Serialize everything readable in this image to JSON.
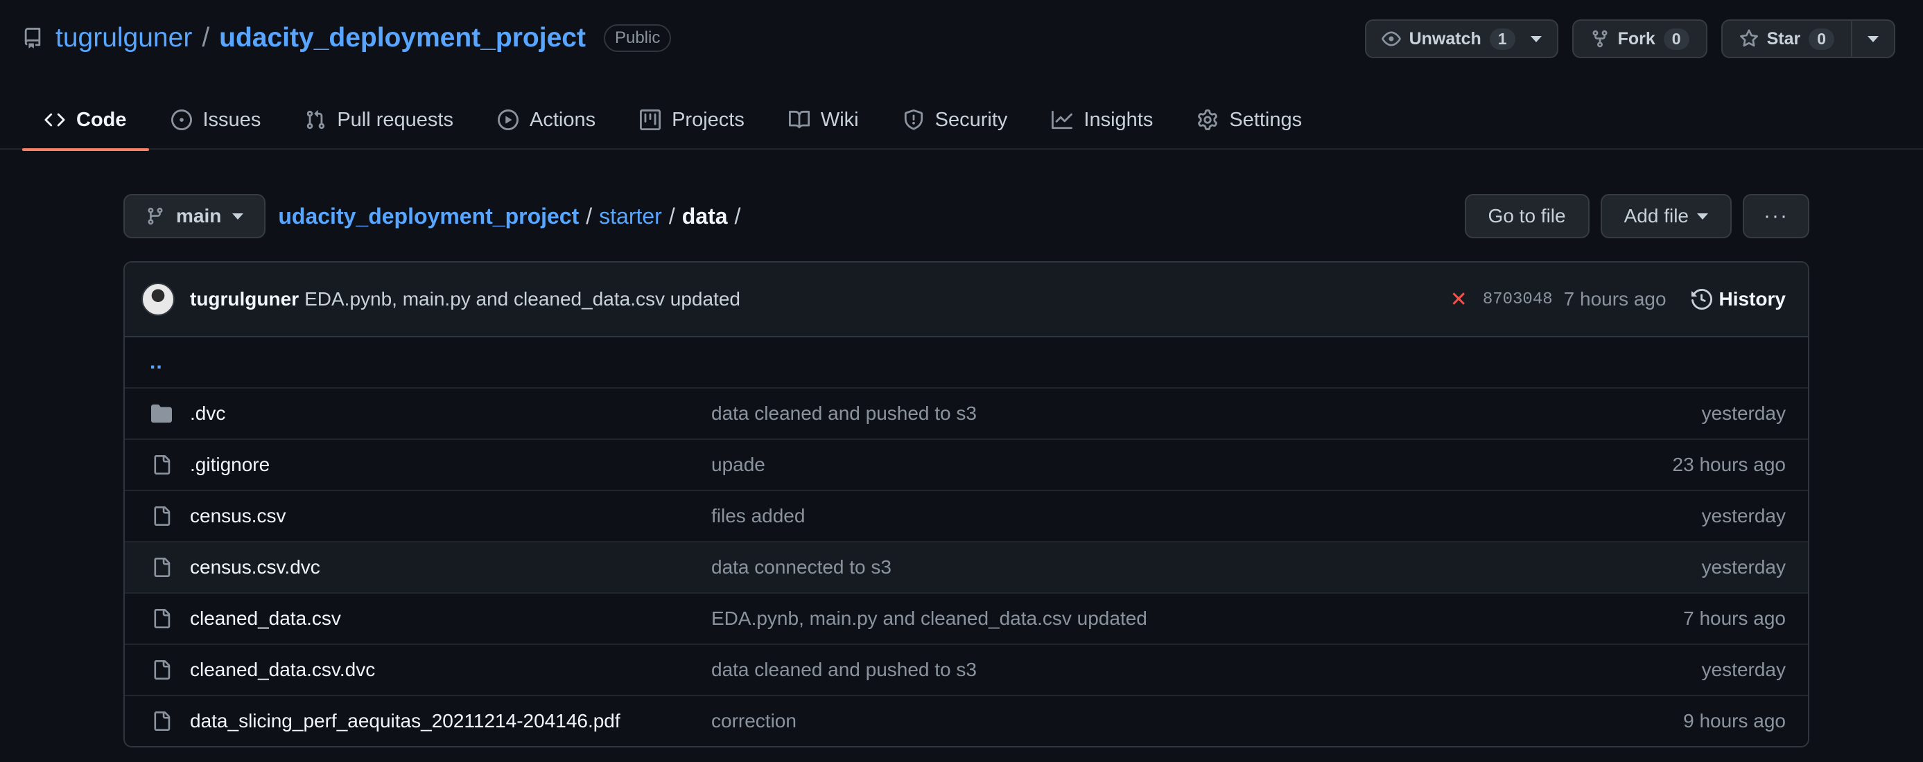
{
  "repo": {
    "owner": "tugrulguner",
    "separator": "/",
    "name": "udacity_deployment_project",
    "visibility": "Public"
  },
  "actions": {
    "watch": {
      "label": "Unwatch",
      "count": "1"
    },
    "fork": {
      "label": "Fork",
      "count": "0"
    },
    "star": {
      "label": "Star",
      "count": "0"
    }
  },
  "tabs": [
    {
      "label": "Code",
      "icon": "code-icon",
      "active": true
    },
    {
      "label": "Issues",
      "icon": "issue-icon"
    },
    {
      "label": "Pull requests",
      "icon": "pull-request-icon"
    },
    {
      "label": "Actions",
      "icon": "play-icon"
    },
    {
      "label": "Projects",
      "icon": "project-icon"
    },
    {
      "label": "Wiki",
      "icon": "book-icon"
    },
    {
      "label": "Security",
      "icon": "shield-icon"
    },
    {
      "label": "Insights",
      "icon": "graph-icon"
    },
    {
      "label": "Settings",
      "icon": "gear-icon"
    }
  ],
  "file_nav": {
    "branch": "main",
    "crumbs": {
      "root": "udacity_deployment_project",
      "sub": "starter",
      "current": "data",
      "sep": "/",
      "trail": "/"
    },
    "go_to_file": "Go to file",
    "add_file": "Add file",
    "more": "···"
  },
  "last_commit": {
    "author": "tugrulguner",
    "message": "EDA.pynb, main.py and cleaned_data.csv updated",
    "status": "✕",
    "sha": "8703048",
    "age": "7 hours ago",
    "history": "History"
  },
  "parent_dir": "..",
  "files": [
    {
      "name": ".dvc",
      "type": "dir",
      "message": "data cleaned and pushed to s3",
      "age": "yesterday"
    },
    {
      "name": ".gitignore",
      "type": "file",
      "message": "upade",
      "age": "23 hours ago"
    },
    {
      "name": "census.csv",
      "type": "file",
      "message": "files added",
      "age": "yesterday"
    },
    {
      "name": "census.csv.dvc",
      "type": "file",
      "message": "data connected to s3",
      "age": "yesterday"
    },
    {
      "name": "cleaned_data.csv",
      "type": "file",
      "message": "EDA.pynb, main.py and cleaned_data.csv updated",
      "age": "7 hours ago"
    },
    {
      "name": "cleaned_data.csv.dvc",
      "type": "file",
      "message": "data cleaned and pushed to s3",
      "age": "yesterday"
    },
    {
      "name": "data_slicing_perf_aequitas_20211214-204146.pdf",
      "type": "file",
      "message": "correction",
      "age": "9 hours ago"
    }
  ],
  "colors": {
    "background": "#0d1117",
    "link": "#58a6ff",
    "active_tab_underline": "#f78166",
    "fail_status": "#f85149"
  }
}
